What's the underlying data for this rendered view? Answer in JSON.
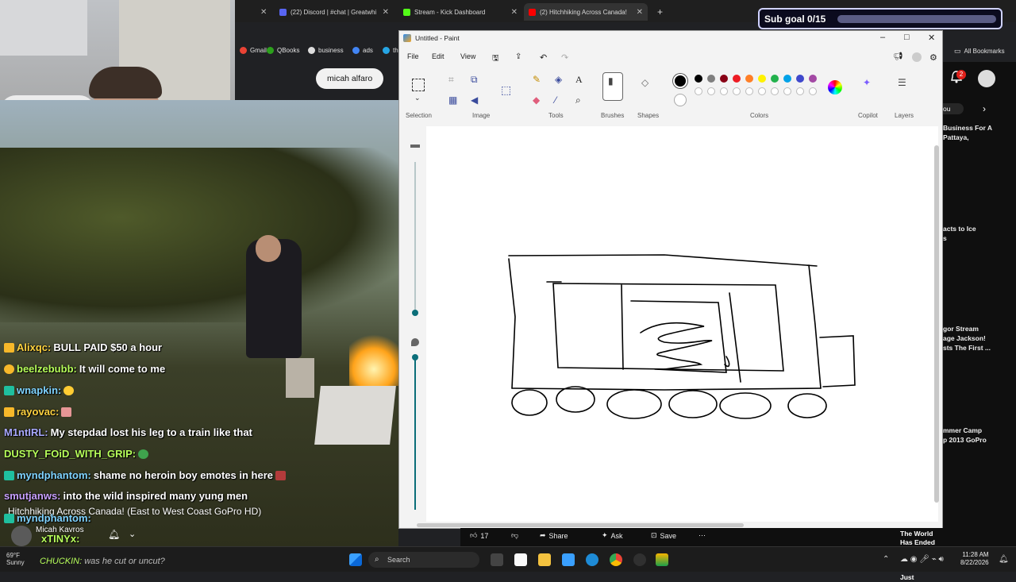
{
  "browser": {
    "tabs": [
      {
        "label": "(22) Discord | #chat | Greatwhi"
      },
      {
        "label": "Stream - Kick Dashboard"
      },
      {
        "label": "(2) Hitchhiking Across Canada!"
      }
    ],
    "bookmarks": [
      "Gmail",
      "QBooks",
      "business",
      "ads",
      "th"
    ],
    "all_bookmarks": "All Bookmarks",
    "notif_count": "2"
  },
  "search_chip": "micah alfaro",
  "sub_goal": "Sub goal 0/15",
  "chat": [
    {
      "user": "Alixqc:",
      "text": "BULL PAID $50 a hour",
      "color": "#ffd23f"
    },
    {
      "user": "beelzebubb:",
      "text": "It will come to me",
      "color": "#b7ff5a"
    },
    {
      "user": "wnapkin:",
      "text": "",
      "color": "#7fd3ff"
    },
    {
      "user": "rayovac:",
      "text": "",
      "color": "#ffd23f"
    },
    {
      "user": "M1ntIRL:",
      "text": "My stepdad lost his leg to a train like that",
      "color": "#a9a9ff"
    },
    {
      "user": "DUSTY_FOiD_WITH_GRIP:",
      "text": "",
      "color": "#b7ff5a"
    },
    {
      "user": "myndphantom:",
      "text": "shame no heroin boy emotes in here",
      "color": "#7fd3ff"
    },
    {
      "user": "smutjanws:",
      "text": "into the wild inspired many yung men",
      "color": "#c8a0ff"
    },
    {
      "user": "myndphantom:",
      "text": "",
      "color": "#7fd3ff"
    },
    {
      "user": "xTINYx:",
      "text": "",
      "color": "#b7ff5a"
    },
    {
      "user": "CHUCKIN:",
      "text": "was he cut or uncut?",
      "color": "#b7ff5a"
    }
  ],
  "video_title": "Hitchhiking Across Canada! (East to West Coast GoPro HD)",
  "channel_name": "Micah Kavros",
  "paint": {
    "title": "Untitled - Paint",
    "menus": [
      "File",
      "Edit",
      "View"
    ],
    "groups": [
      "Selection",
      "Image",
      "Tools",
      "Brushes",
      "Shapes",
      "Colors",
      "Copilot",
      "Layers"
    ],
    "palette_row1": [
      "#000000",
      "#7f7f7f",
      "#880015",
      "#ed1c24",
      "#ff7f27",
      "#fff200",
      "#22b14c",
      "#00a2e8",
      "#3f48cc",
      "#a349a4"
    ],
    "palette_row2": [
      "#ffffff",
      "#c3c3c3",
      "#b97a57",
      "#ffaec9",
      "#ffc90e",
      "#efe4b0",
      "#b5e61d",
      "#99d9ea",
      "#7092be",
      "#c8bfe7"
    ]
  },
  "yt_side": [
    {
      "text": "ou"
    },
    {
      "text": "Business For A"
    },
    {
      "text": "Pattaya,"
    },
    {
      "text": "acts to Ice"
    },
    {
      "text": "s"
    },
    {
      "text": "gor Stream"
    },
    {
      "text": "age Jackson!"
    },
    {
      "text": "sts The First ..."
    },
    {
      "text": "mmer Camp"
    },
    {
      "text": "p 2013 GoPro"
    }
  ],
  "yt_actions": {
    "likes": "17",
    "share": "Share",
    "ask": "Ask",
    "save": "Save"
  },
  "yt_bottom_title": [
    "The World Has Ended For",
    "Average Men. You Just"
  ],
  "taskbar": {
    "search": "Search",
    "weather_temp": "69°F",
    "weather_desc": "Sunny",
    "time": "11:28 AM",
    "date": "8/22/2026"
  }
}
